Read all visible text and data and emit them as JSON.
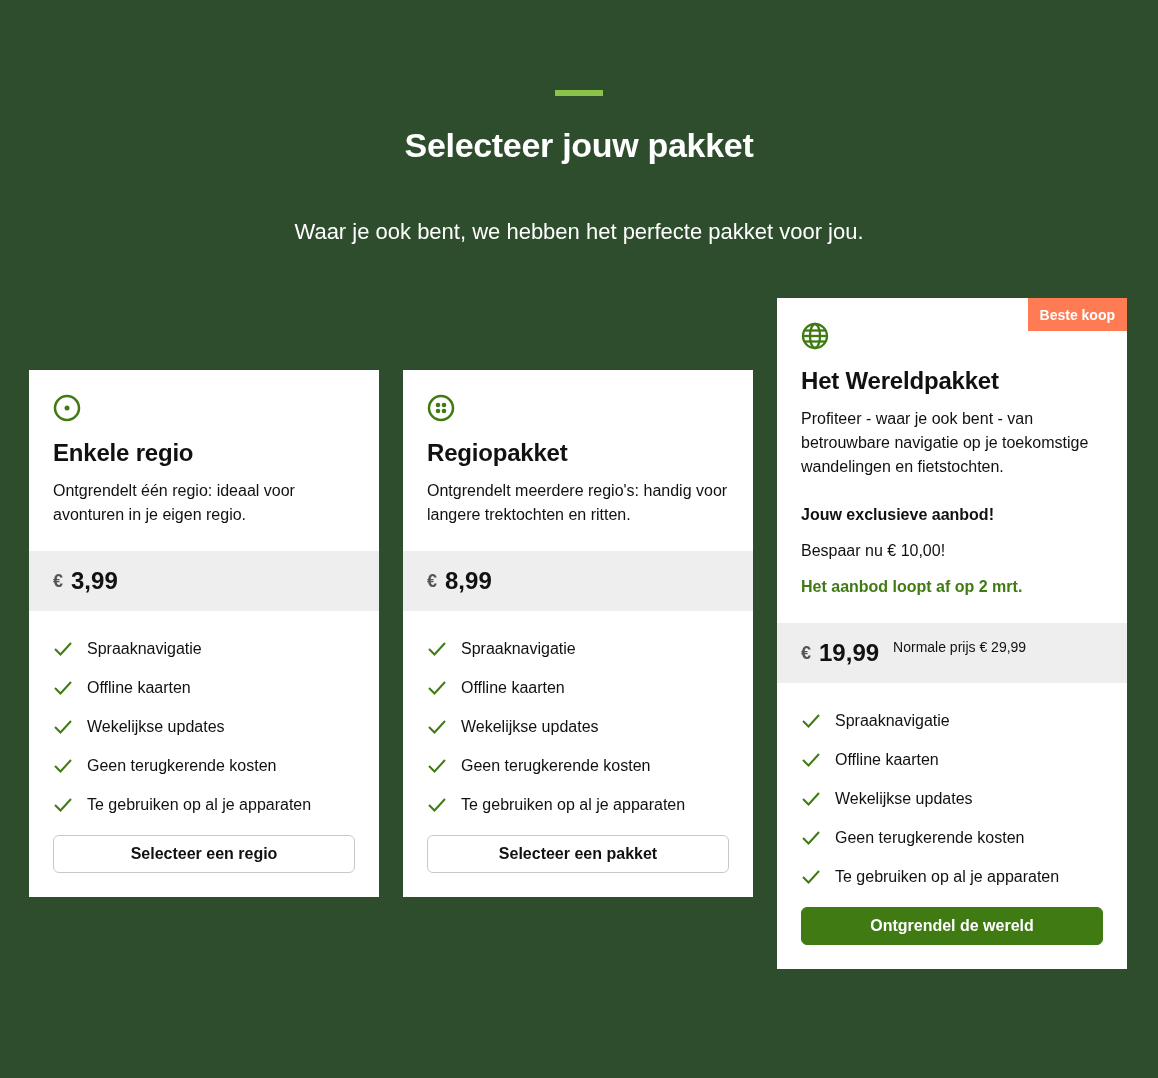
{
  "header": {
    "title": "Selecteer jouw pakket",
    "subtitle": "Waar je ook bent, we hebben het perfecte pakket voor jou."
  },
  "plans": [
    {
      "kind": "single",
      "name": "Enkele regio",
      "description": "Ontgrendelt één regio: ideaal voor avonturen in je eigen regio.",
      "currency": "€",
      "price": "3,99",
      "features": [
        "Spraaknavigatie",
        "Offline kaarten",
        "Wekelijkse updates",
        "Geen terugkerende kosten",
        "Te gebruiken op al je apparaten"
      ],
      "button": {
        "label": "Selecteer een regio",
        "kind": "outline"
      }
    },
    {
      "kind": "bundle",
      "name": "Regiopakket",
      "description": "Ontgrendelt meerdere regio's: handig voor langere trektochten en ritten.",
      "currency": "€",
      "price": "8,99",
      "features": [
        "Spraaknavigatie",
        "Offline kaarten",
        "Wekelijkse updates",
        "Geen terugkerende kosten",
        "Te gebruiken op al je apparaten"
      ],
      "button": {
        "label": "Selecteer een pakket",
        "kind": "outline"
      }
    },
    {
      "kind": "world",
      "badge": "Beste koop",
      "name": "Het Wereldpakket",
      "description": "Profiteer - waar je ook bent - van betrouwbare navigatie op je toekomstige wandelingen en fietstochten.",
      "offer": {
        "heading": "Jouw exclusieve aanbod!",
        "savings": "Bespaar nu € 10,00!",
        "deadline": "Het aanbod loopt af op 2 mrt."
      },
      "currency": "€",
      "price": "19,99",
      "normal_price": "Normale prijs € 29,99",
      "features": [
        "Spraaknavigatie",
        "Offline kaarten",
        "Wekelijkse updates",
        "Geen terugkerende kosten",
        "Te gebruiken op al je apparaten"
      ],
      "button": {
        "label": "Ontgrendel de wereld",
        "kind": "primary"
      }
    }
  ]
}
